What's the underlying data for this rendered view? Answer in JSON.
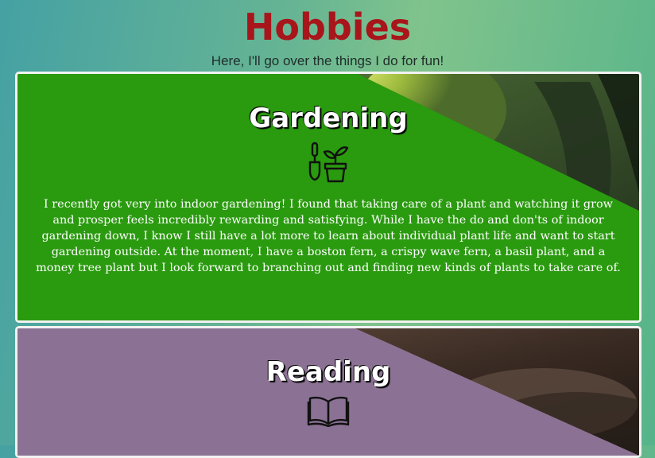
{
  "header": {
    "title": "Hobbies",
    "subtitle": "Here, I'll go over the things I do for fun!"
  },
  "hobbies": [
    {
      "title": "Gardening",
      "icon": "gardening-tools-plant-pot-icon",
      "text": "I recently got very into indoor gardening! I found that taking care of a plant and watching it grow and prosper feels incredibly rewarding and satisfying. While I have the do and don'ts of indoor gardening down, I know I still have a lot more to learn about individual plant life and want to start gardening outside. At the moment, I have a boston fern, a crispy wave fern, a basil plant, and a money tree plant but I look forward to branching out and finding new kinds of plants to take care of.",
      "color": "#2a9a0f"
    },
    {
      "title": "Reading",
      "icon": "open-book-icon",
      "color": "#8b7294"
    }
  ],
  "colors": {
    "title": "#a8151a",
    "card_border": "#f2f2f2"
  }
}
